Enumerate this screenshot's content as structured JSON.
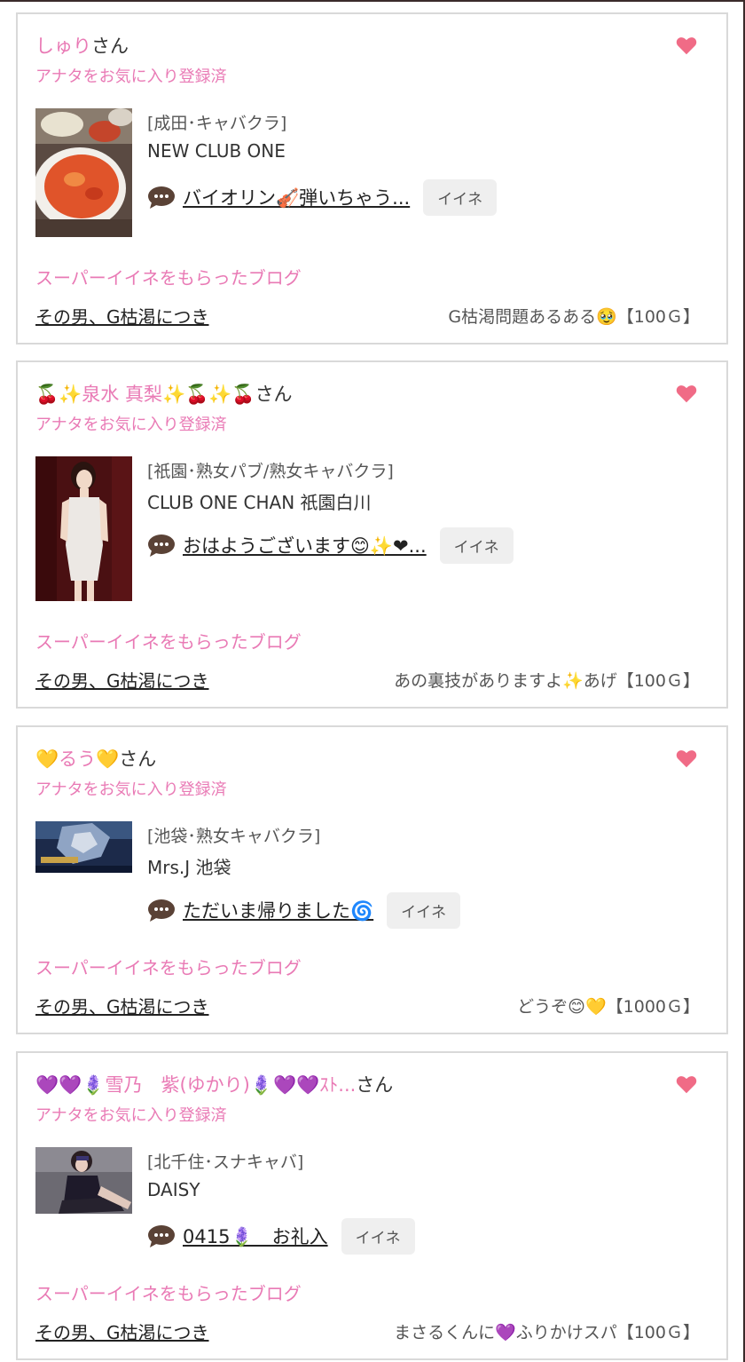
{
  "cards": [
    {
      "name_pink": "しゅり",
      "name_suffix": "さん",
      "fav_label": "アナタをお気に入り登録済",
      "shop_category": "[成田･キャバクラ]",
      "shop_name": "NEW CLUB ONE",
      "message": "バイオリン🎻弾いちゃう...",
      "iine_label": "イイネ",
      "super_label": "スーパーイイネをもらったブログ",
      "blog_link": "その男、G枯渇につき",
      "blog_title": "G枯渇問題あるある🥹【100Ｇ】"
    },
    {
      "name_pink": "🍒✨泉水 真梨✨🍒✨🍒",
      "name_suffix": "さん",
      "fav_label": "アナタをお気に入り登録済",
      "shop_category": "[祇園･熟女パブ/熟女キャバクラ]",
      "shop_name": "CLUB ONE CHAN 祇園白川",
      "message": "おはようございます😊✨❤...",
      "iine_label": "イイネ",
      "super_label": "スーパーイイネをもらったブログ",
      "blog_link": "その男、G枯渇につき",
      "blog_title": "あの裏技がありますよ✨あげ【100Ｇ】"
    },
    {
      "name_pink": "💛るう💛",
      "name_suffix": "さん",
      "fav_label": "アナタをお気に入り登録済",
      "shop_category": "[池袋･熟女キャバクラ]",
      "shop_name": "Mrs.J 池袋",
      "message": "ただいま帰りました🌀",
      "iine_label": "イイネ",
      "super_label": "スーパーイイネをもらったブログ",
      "blog_link": "その男、G枯渇につき",
      "blog_title": "どうぞ😊💛【1000Ｇ】"
    },
    {
      "name_pink": "💜💜🪻雪乃　紫(ゆかり)🪻💜💜ｽﾄ...",
      "name_suffix": "さん",
      "fav_label": "アナタをお気に入り登録済",
      "shop_category": "[北千住･スナキャバ]",
      "shop_name": "DAISY",
      "message": "0415🪻　お礼入",
      "iine_label": "イイネ",
      "super_label": "スーパーイイネをもらったブログ",
      "blog_link": "その男、G枯渇につき",
      "blog_title": "まさるくんに💜ふりかけスパ【100Ｇ】"
    }
  ],
  "colors": {
    "accent_pink": "#e97ab5",
    "heart": "#f06b86",
    "bubble": "#5a4236",
    "border": "#d9d9d9"
  },
  "icons": {
    "heart": "heart-icon",
    "speech_bubble": "speech-bubble-icon"
  }
}
